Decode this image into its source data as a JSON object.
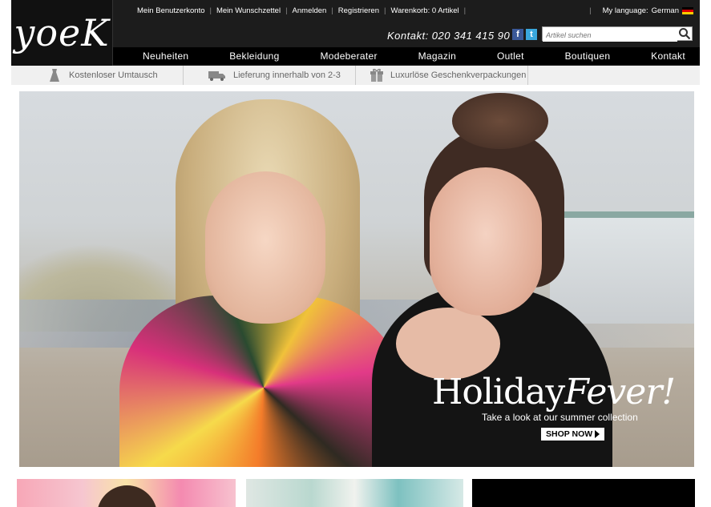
{
  "logo": {
    "text": "yoeK"
  },
  "topnav": {
    "links": [
      "Mein Benutzerkonto",
      "Mein Wunschzettel",
      "Anmelden",
      "Registrieren",
      "Warenkorb: 0 Artikel"
    ],
    "language_label": "My language:",
    "language_value": "German"
  },
  "contact": "Kontakt: 020 341 415 90",
  "social": {
    "facebook": "f",
    "twitter": "t"
  },
  "search": {
    "placeholder": "Artikel suchen",
    "value": ""
  },
  "mainnav": [
    "Neuheiten",
    "Bekleidung",
    "Modeberater",
    "Magazin",
    "Outlet",
    "Boutiquen",
    "Kontakt"
  ],
  "features": [
    {
      "label": "Kostenloser Umtausch",
      "icon": "dress-icon"
    },
    {
      "label": "Lieferung innerhalb von 2-3",
      "icon": "truck-icon"
    },
    {
      "label": "Luxurlöse Geschenkverpackungen",
      "icon": "gift-icon"
    }
  ],
  "hero": {
    "title_main": "Holiday",
    "title_italic": "Fever!",
    "subtitle": "Take a look at our summer collection",
    "button": "SHOP NOW"
  },
  "colors": {
    "header_bg": "#1c1c1c",
    "nav_bg": "#000000",
    "features_bg": "#f0f0f0"
  }
}
